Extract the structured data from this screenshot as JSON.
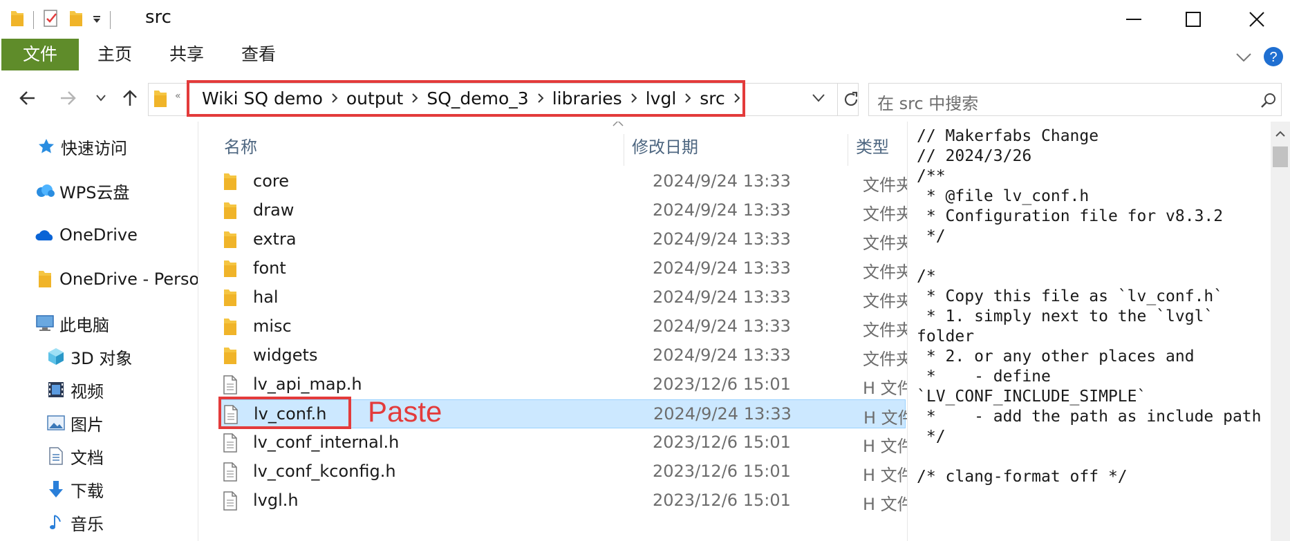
{
  "window": {
    "title": "src"
  },
  "ribbon": {
    "tabs": [
      {
        "label": "文件"
      },
      {
        "label": "主页"
      },
      {
        "label": "共享"
      },
      {
        "label": "查看"
      }
    ]
  },
  "address": {
    "breadcrumbs": [
      "Wiki SQ demo",
      "output",
      "SQ_demo_3",
      "libraries",
      "lvgl",
      "src"
    ]
  },
  "search": {
    "placeholder": "在 src 中搜索"
  },
  "navpane": {
    "items": [
      {
        "label": "快速访问",
        "icon": "star-icon"
      },
      {
        "label": "WPS云盘",
        "icon": "cloud-icon"
      },
      {
        "label": "OneDrive",
        "icon": "onedrive-icon"
      },
      {
        "label": "OneDrive - Perso",
        "icon": "folder-icon"
      },
      {
        "label": "此电脑",
        "icon": "computer-icon"
      },
      {
        "label": "3D 对象",
        "icon": "cube-icon"
      },
      {
        "label": "视频",
        "icon": "video-icon"
      },
      {
        "label": "图片",
        "icon": "picture-icon"
      },
      {
        "label": "文档",
        "icon": "document-icon"
      },
      {
        "label": "下载",
        "icon": "download-icon"
      },
      {
        "label": "音乐",
        "icon": "music-icon"
      }
    ]
  },
  "filelist": {
    "columns": {
      "name": "名称",
      "date": "修改日期",
      "type": "类型"
    },
    "rows": [
      {
        "name": "core",
        "date": "2024/9/24 13:33",
        "type": "文件夹",
        "kind": "folder"
      },
      {
        "name": "draw",
        "date": "2024/9/24 13:33",
        "type": "文件夹",
        "kind": "folder"
      },
      {
        "name": "extra",
        "date": "2024/9/24 13:33",
        "type": "文件夹",
        "kind": "folder"
      },
      {
        "name": "font",
        "date": "2024/9/24 13:33",
        "type": "文件夹",
        "kind": "folder"
      },
      {
        "name": "hal",
        "date": "2024/9/24 13:33",
        "type": "文件夹",
        "kind": "folder"
      },
      {
        "name": "misc",
        "date": "2024/9/24 13:33",
        "type": "文件夹",
        "kind": "folder"
      },
      {
        "name": "widgets",
        "date": "2024/9/24 13:33",
        "type": "文件夹",
        "kind": "folder"
      },
      {
        "name": "lv_api_map.h",
        "date": "2023/12/6 15:01",
        "type": "H 文件",
        "kind": "file"
      },
      {
        "name": "lv_conf.h",
        "date": "2024/9/24 13:33",
        "type": "H 文件",
        "kind": "file"
      },
      {
        "name": "lv_conf_internal.h",
        "date": "2023/12/6 15:01",
        "type": "H 文件",
        "kind": "file"
      },
      {
        "name": "lv_conf_kconfig.h",
        "date": "2023/12/6 15:01",
        "type": "H 文件",
        "kind": "file"
      },
      {
        "name": "lvgl.h",
        "date": "2023/12/6 15:01",
        "type": "H 文件",
        "kind": "file"
      }
    ],
    "selected_index": 8,
    "annotation": "Paste"
  },
  "preview": {
    "lines": [
      "// Makerfabs Change",
      "// 2024/3/26",
      "/**",
      " * @file lv_conf.h",
      " * Configuration file for v8.3.2",
      " */",
      "",
      "/*",
      " * Copy this file as `lv_conf.h`",
      " * 1. simply next to the `lvgl`",
      "folder",
      " * 2. or any other places and",
      " *    - define",
      "`LV_CONF_INCLUDE_SIMPLE`",
      " *    - add the path as include path",
      " */",
      "",
      "/* clang-format off */"
    ]
  },
  "colors": {
    "file_tab": "#5f8c2a",
    "selection": "#cce8ff",
    "annotation": "#e33b3b",
    "folder": "#f5c542"
  }
}
